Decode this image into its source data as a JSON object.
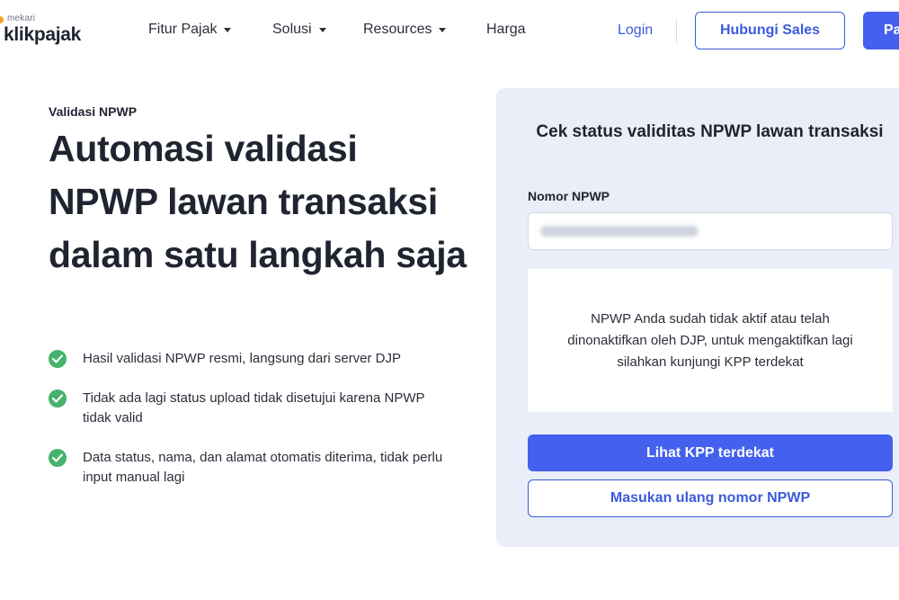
{
  "brand": {
    "tagline": "mekari",
    "name": "klikpajak",
    "accent_color": "#f5a623"
  },
  "nav": {
    "items": [
      {
        "label": "Fitur Pajak",
        "has_dropdown": true
      },
      {
        "label": "Solusi",
        "has_dropdown": true
      },
      {
        "label": "Resources",
        "has_dropdown": true
      },
      {
        "label": "Harga",
        "has_dropdown": false
      }
    ],
    "login_label": "Login",
    "sales_button_label": "Hubungi Sales",
    "cta_partial_label": "Pa"
  },
  "hero": {
    "eyebrow": "Validasi NPWP",
    "title": "Automasi validasi NPWP lawan transaksi dalam satu langkah saja",
    "features": [
      "Hasil validasi NPWP resmi, langsung dari server DJP",
      "Tidak ada lagi status upload tidak disetujui karena NPWP tidak valid",
      "Data status, nama, dan alamat otomatis diterima, tidak perlu input manual lagi"
    ]
  },
  "card": {
    "title": "Cek status validitas NPWP lawan transaksi",
    "field_label": "Nomor NPWP",
    "message": "NPWP Anda sudah tidak aktif atau telah dinonaktifkan oleh DJP, untuk mengaktifkan lagi silahkan kunjungi KPP terdekat",
    "primary_button": "Lihat KPP terdekat",
    "secondary_button": "Masukan ulang nomor NPWP"
  },
  "colors": {
    "primary": "#4361ee",
    "primary_text": "#3b5bdb",
    "success": "#45b36b",
    "card_bg": "#eaeef8"
  }
}
